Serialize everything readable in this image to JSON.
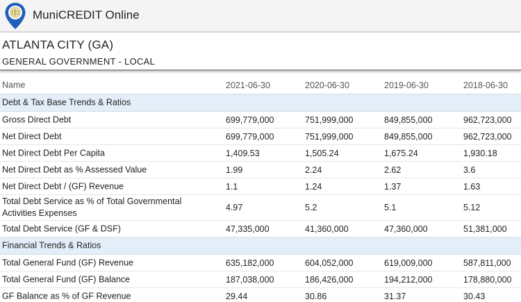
{
  "app": {
    "title": "MuniCREDIT Online"
  },
  "entity": {
    "name": "ATLANTA CITY (GA)",
    "type": "GENERAL GOVERNMENT - LOCAL"
  },
  "table": {
    "name_header": "Name",
    "periods": [
      "2021-06-30",
      "2020-06-30",
      "2019-06-30",
      "2018-06-30"
    ],
    "sections": [
      {
        "title": "Debt & Tax Base Trends & Ratios",
        "rows": [
          {
            "name": "Gross Direct Debt",
            "values": [
              "699,779,000",
              "751,999,000",
              "849,855,000",
              "962,723,000"
            ]
          },
          {
            "name": "Net Direct Debt",
            "values": [
              "699,779,000",
              "751,999,000",
              "849,855,000",
              "962,723,000"
            ]
          },
          {
            "name": "Net Direct Debt Per Capita",
            "values": [
              "1,409.53",
              "1,505.24",
              "1,675.24",
              "1,930.18"
            ]
          },
          {
            "name": "Net Direct Debt as % Assessed Value",
            "values": [
              "1.99",
              "2.24",
              "2.62",
              "3.6"
            ]
          },
          {
            "name": "Net Direct Debt / (GF) Revenue",
            "values": [
              "1.1",
              "1.24",
              "1.37",
              "1.63"
            ]
          },
          {
            "name": "Total Debt Service as % of Total Governmental Activities Expenses",
            "values": [
              "4.97",
              "5.2",
              "5.1",
              "5.12"
            ]
          },
          {
            "name": "Total Debt Service (GF & DSF)",
            "values": [
              "47,335,000",
              "41,360,000",
              "47,360,000",
              "51,381,000"
            ]
          }
        ]
      },
      {
        "title": "Financial Trends & Ratios",
        "rows": [
          {
            "name": "Total General Fund (GF) Revenue",
            "values": [
              "635,182,000",
              "604,052,000",
              "619,009,000",
              "587,811,000"
            ]
          },
          {
            "name": "Total General Fund (GF) Balance",
            "values": [
              "187,038,000",
              "186,426,000",
              "194,212,000",
              "178,880,000"
            ]
          },
          {
            "name": "GF Balance as % of GF Revenue",
            "values": [
              "29.44",
              "30.86",
              "31.37",
              "30.43"
            ]
          }
        ]
      }
    ]
  }
}
